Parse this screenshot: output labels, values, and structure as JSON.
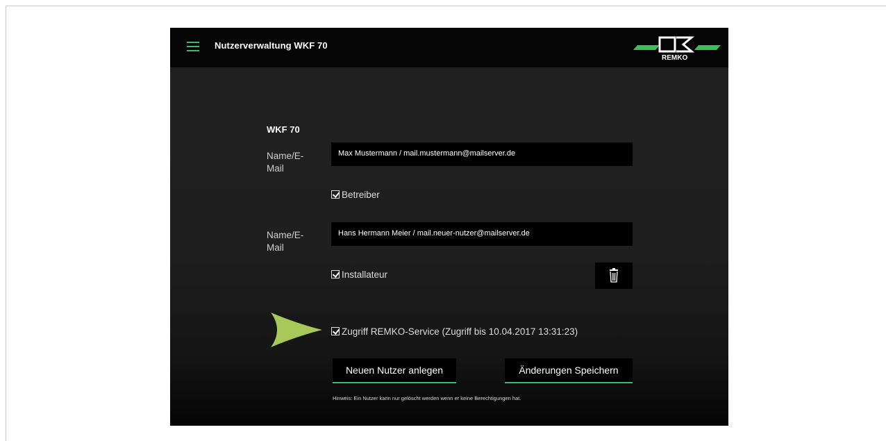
{
  "header": {
    "title": "Nutzerverwaltung WKF 70",
    "menu_icon": "hamburger-menu-icon",
    "logo_text": "REMKO",
    "accent_color": "#3dbe5b"
  },
  "form": {
    "section_title": "WKF 70",
    "users": [
      {
        "label": "Name/E-\nMail",
        "value": "Max Mustermann / mail.mustermann@mailserver.de",
        "role_label": "Betreiber",
        "role_checked": true
      },
      {
        "label": "Name/E-\nMail",
        "value": "Hans Hermann Meier / mail.neuer-nutzer@mailserver.de",
        "role_label": "Installateur",
        "role_checked": true
      }
    ],
    "delete_icon": "trash-icon",
    "service_access": {
      "label": "Zugriff REMKO-Service (Zugriff bis 10.04.2017 13:31:23)",
      "checked": true
    },
    "buttons": {
      "new_user": "Neuen Nutzer anlegen",
      "save": "Änderungen Speichern"
    },
    "hint": "Hinweis: Ein Nutzer kann nur gelöscht werden wenn er keine Berechtigungen hat."
  },
  "annotation": {
    "arrow_color": "#a8c85a"
  }
}
